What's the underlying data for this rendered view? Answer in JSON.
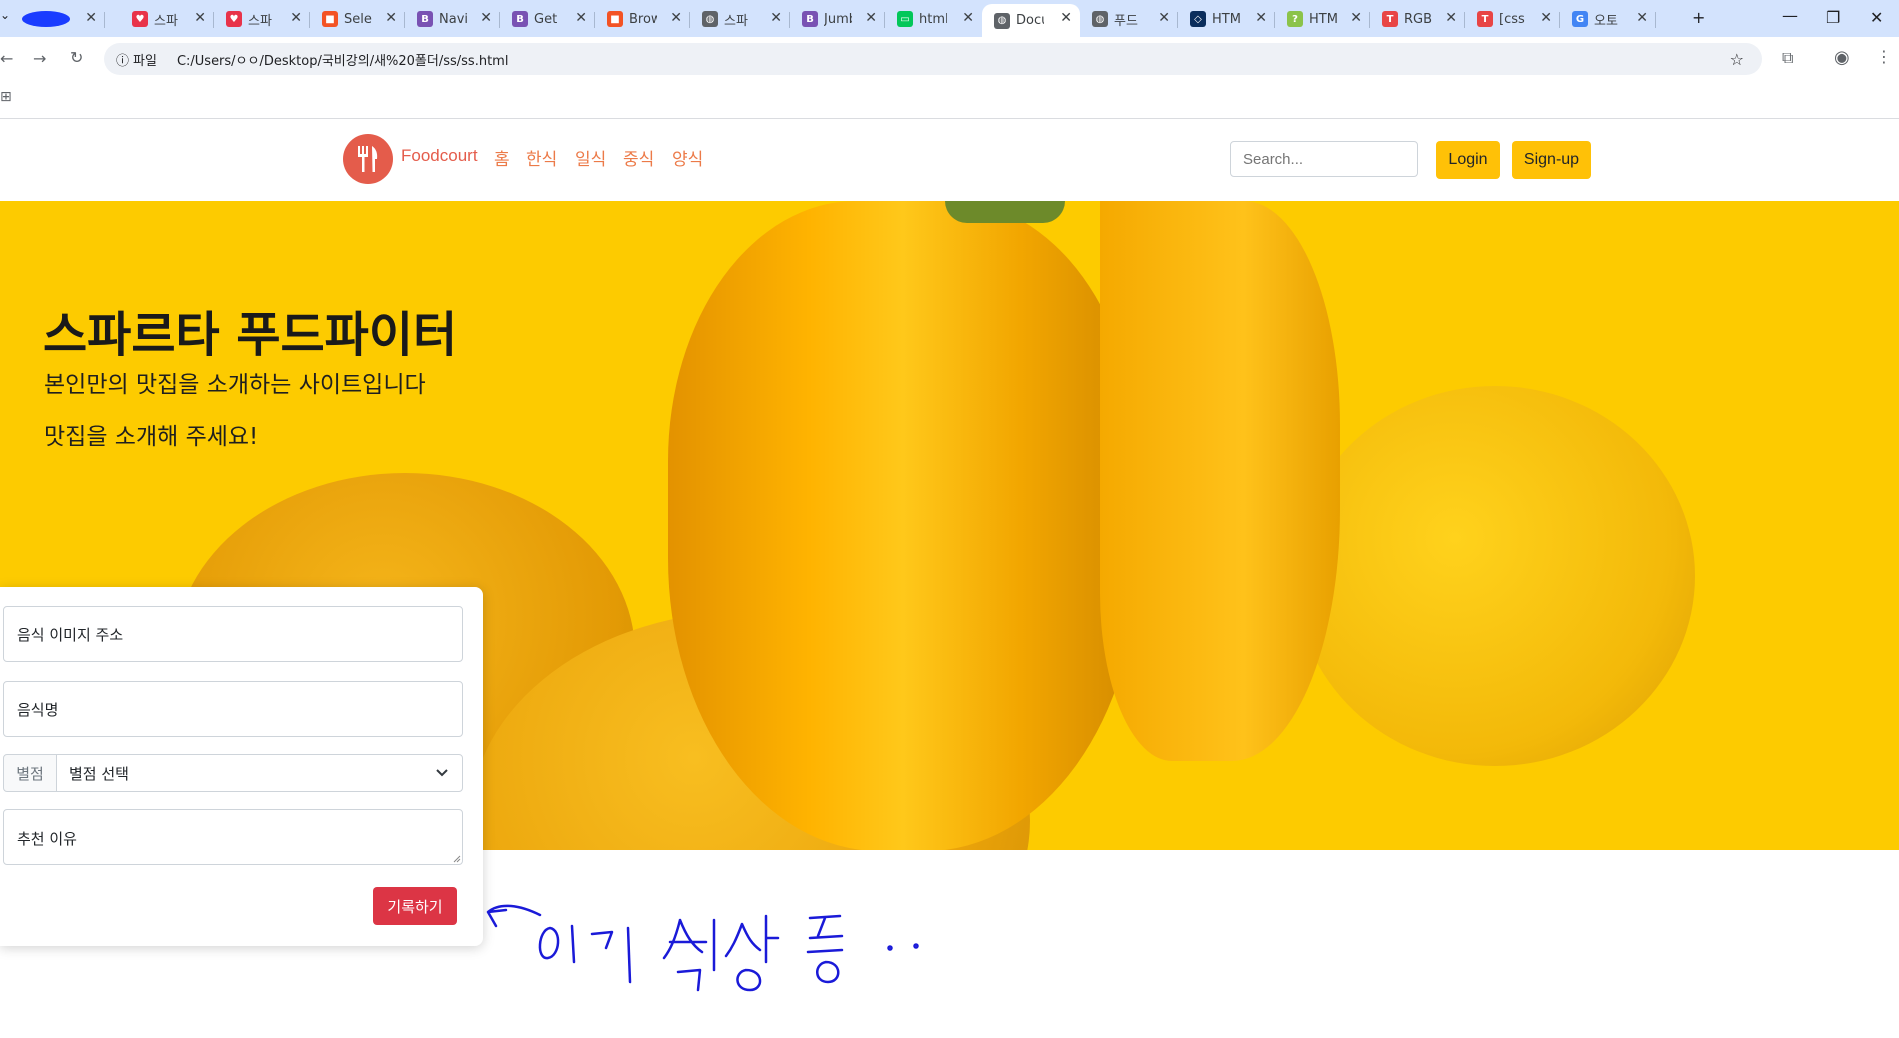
{
  "browser": {
    "tabs": [
      {
        "title": "",
        "favicon_color": "#1a3cff",
        "favicon_glyph": ""
      },
      {
        "title": "스파",
        "favicon_color": "#e8334a",
        "favicon_glyph": "♥"
      },
      {
        "title": "스파",
        "favicon_color": "#e8334a",
        "favicon_glyph": "♥"
      },
      {
        "title": "Selec",
        "favicon_color": "#f35325",
        "favicon_glyph": "■"
      },
      {
        "title": "Navi",
        "favicon_color": "#7952b3",
        "favicon_glyph": "B"
      },
      {
        "title": "Get",
        "favicon_color": "#7952b3",
        "favicon_glyph": "B"
      },
      {
        "title": "Brow",
        "favicon_color": "#f35325",
        "favicon_glyph": "■"
      },
      {
        "title": "스파",
        "favicon_color": "#5f6368",
        "favicon_glyph": "◍"
      },
      {
        "title": "Jumb",
        "favicon_color": "#7952b3",
        "favicon_glyph": "B"
      },
      {
        "title": "html",
        "favicon_color": "#03c75a",
        "favicon_glyph": "▭"
      },
      {
        "title": "Docu",
        "favicon_color": "#5f6368",
        "favicon_glyph": "◍"
      },
      {
        "title": "푸드",
        "favicon_color": "#5f6368",
        "favicon_glyph": "◍"
      },
      {
        "title": "HTM",
        "favicon_color": "#0a2d5c",
        "favicon_glyph": "◇"
      },
      {
        "title": "HTM",
        "favicon_color": "#8bc34a",
        "favicon_glyph": "?"
      },
      {
        "title": "RGB",
        "favicon_color": "#e84545",
        "favicon_glyph": "T"
      },
      {
        "title": "[css",
        "favicon_color": "#e84545",
        "favicon_glyph": "T"
      },
      {
        "title": "오토",
        "favicon_color": "#4285f4",
        "favicon_glyph": "G"
      }
    ],
    "active_tab_index": 10,
    "address_label": "파일",
    "url": "C:/Users/ㅇㅇ/Desktop/국비강의/새%20폴더/ss/ss.html"
  },
  "navbar": {
    "brand": "Foodcourt",
    "links": [
      "홈",
      "한식",
      "일식",
      "중식",
      "양식"
    ],
    "search_placeholder": "Search...",
    "login_label": "Login",
    "signup_label": "Sign-up",
    "brand_color": "#e45c4b",
    "link_color": "#ec7a48",
    "button_color": "#ffc107"
  },
  "hero": {
    "title": "스파르타 푸드파이터",
    "subtitle": "본인만의 맛집을 소개하는 사이트입니다",
    "subtitle2": "맛집을 소개해 주세요!",
    "bg_color": "#fdcb00"
  },
  "form": {
    "image_url_placeholder": "음식 이미지 주소",
    "food_name_placeholder": "음식명",
    "rating_addon": "별점",
    "rating_select": "별점 선택",
    "reason_placeholder": "추천 이유",
    "submit_label": "기록하기",
    "submit_color": "#dc3545"
  },
  "annotation": {
    "handwritten_note": "이거 설정중 ..",
    "ink_color": "#1a1ad8"
  }
}
